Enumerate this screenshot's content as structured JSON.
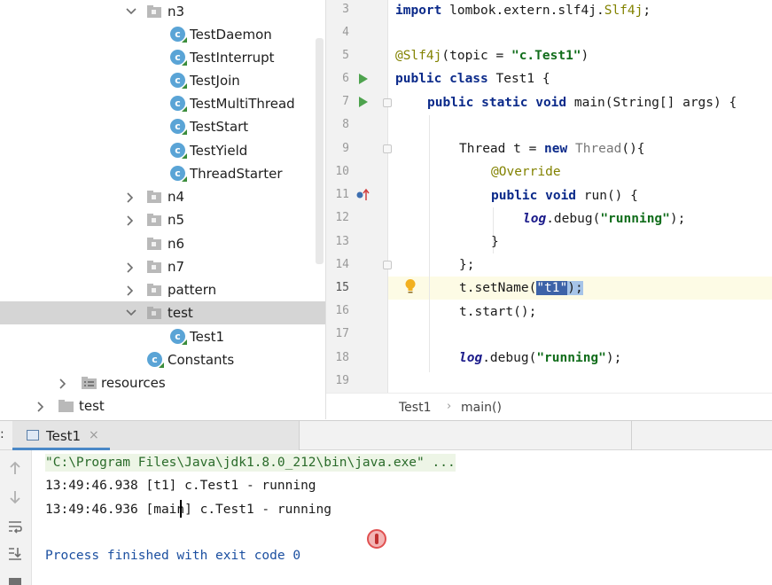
{
  "tree": {
    "items": [
      {
        "label": "n3",
        "type": "package",
        "expanded": true
      },
      {
        "label": "TestDaemon",
        "type": "class"
      },
      {
        "label": "TestInterrupt",
        "type": "class"
      },
      {
        "label": "TestJoin",
        "type": "class"
      },
      {
        "label": "TestMultiThread",
        "type": "class"
      },
      {
        "label": "TestStart",
        "type": "class"
      },
      {
        "label": "TestYield",
        "type": "class"
      },
      {
        "label": "ThreadStarter",
        "type": "class"
      },
      {
        "label": "n4",
        "type": "package",
        "expanded": false
      },
      {
        "label": "n5",
        "type": "package",
        "expanded": false
      },
      {
        "label": "n6",
        "type": "package",
        "expanded": false
      },
      {
        "label": "n7",
        "type": "package",
        "expanded": false
      },
      {
        "label": "pattern",
        "type": "package",
        "expanded": false
      },
      {
        "label": "test",
        "type": "package",
        "expanded": true,
        "selected": true
      },
      {
        "label": "Test1",
        "type": "class"
      },
      {
        "label": "Constants",
        "type": "class"
      },
      {
        "label": "resources",
        "type": "resources-folder",
        "expanded": false
      },
      {
        "label": "test",
        "type": "folder",
        "expanded": false
      }
    ]
  },
  "editor": {
    "line_numbers": [
      "3",
      "4",
      "5",
      "6",
      "7",
      "8",
      "9",
      "10",
      "11",
      "12",
      "13",
      "14",
      "15",
      "16",
      "17",
      "18",
      "19"
    ],
    "current_line": "15",
    "code": {
      "l3_kw": "import",
      "l3_rest": " lombok.extern.slf4j.",
      "l3_cls": "Slf4j",
      "l3_end": ";",
      "l5_ann": "@Slf4j",
      "l5_mid": "(topic = ",
      "l5_str": "\"c.Test1\"",
      "l5_end": ")",
      "l6_kw": "public class",
      "l6_rest": " Test1 {",
      "l7_kw": "public static void",
      "l7_rest": " main(String[] args) {",
      "l9_a": "Thread t = ",
      "l9_kw": "new",
      "l9_b": " Thread",
      "l9_c": "(){",
      "l10_ann": "@Override",
      "l11_kw": "public void",
      "l11_rest": " run() {",
      "l12_it": "log",
      "l12_mid": ".debug(",
      "l12_str": "\"running\"",
      "l12_end": ");",
      "l13": "}",
      "l14": "};",
      "l15_a": "t.setName(",
      "l15_str": "\"t1\"",
      "l15_end": ");",
      "l16": "t.start();",
      "l18_it": "log",
      "l18_mid": ".debug(",
      "l18_str": "\"running\"",
      "l18_end": ");"
    },
    "breadcrumb": [
      "Test1",
      "main()"
    ],
    "breadcrumb_sep": "›"
  },
  "run_panel": {
    "colon": ":",
    "tab_label": "Test1",
    "tab_close": "×",
    "console_lines": [
      "\"C:\\Program Files\\Java\\jdk1.8.0_212\\bin\\java.exe\" ...",
      "13:49:46.938 [t1] c.Test1 - running",
      "13:49:46.936 [main] c.Test1 - running",
      "Process finished with exit code 0"
    ]
  },
  "colors": {
    "keyword": "#0b2a8a",
    "string": "#116d1b",
    "annotation": "#828200",
    "selection": "#3d63a8",
    "tab_accent": "#4a88c7"
  }
}
